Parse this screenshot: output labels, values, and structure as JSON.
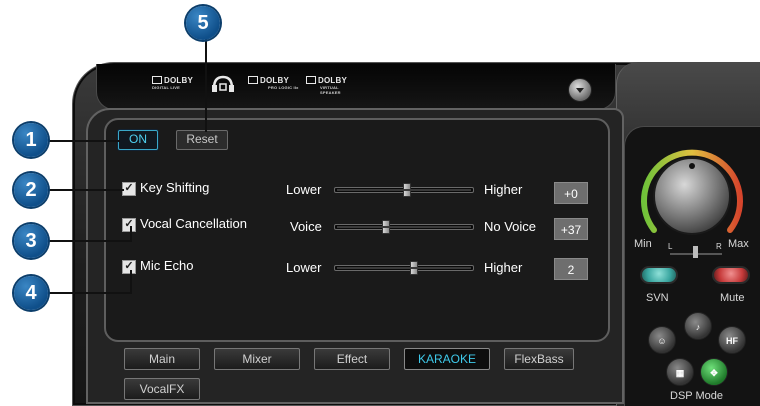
{
  "callouts": [
    "1",
    "2",
    "3",
    "4",
    "5"
  ],
  "header": {
    "logos": [
      {
        "name": "DOLBY",
        "sub": "DIGITAL LIVE"
      },
      {
        "name": "",
        "sub": ""
      },
      {
        "name": "DOLBY",
        "sub": "PRO LOGIC IIx"
      },
      {
        "name": "DOLBY",
        "sub": "VIRTUAL SPEAKER"
      }
    ]
  },
  "controls": {
    "on_label": "ON",
    "reset_label": "Reset"
  },
  "sliders": [
    {
      "name": "Key Shifting",
      "checked": true,
      "left_label": "Lower",
      "right_label": "Higher",
      "value": "+0",
      "position": 0.52
    },
    {
      "name": "Vocal Cancellation",
      "checked": true,
      "left_label": "Voice",
      "right_label": "No Voice",
      "value": "+37",
      "position": 0.37
    },
    {
      "name": "Mic Echo",
      "checked": true,
      "left_label": "Lower",
      "right_label": "Higher",
      "value": "2",
      "position": 0.57
    }
  ],
  "tabs": [
    "Main",
    "Mixer",
    "Effect",
    "KARAOKE",
    "FlexBass",
    "VocalFX"
  ],
  "active_tab": "KARAOKE",
  "volume": {
    "min_label": "Min",
    "max_label": "Max",
    "left_label": "L",
    "right_label": "R"
  },
  "dsp": {
    "svn_label": "SVN",
    "mute_label": "Mute",
    "mode_label": "DSP Mode",
    "hf_label": "HF"
  },
  "colors": {
    "accent": "#3ec9ea",
    "callout": "#1664a8",
    "dial_green": "#6fc23a",
    "dial_red": "#d6452c",
    "svn_teal": "#3aa6a0",
    "mute_red": "#c63a3a"
  }
}
